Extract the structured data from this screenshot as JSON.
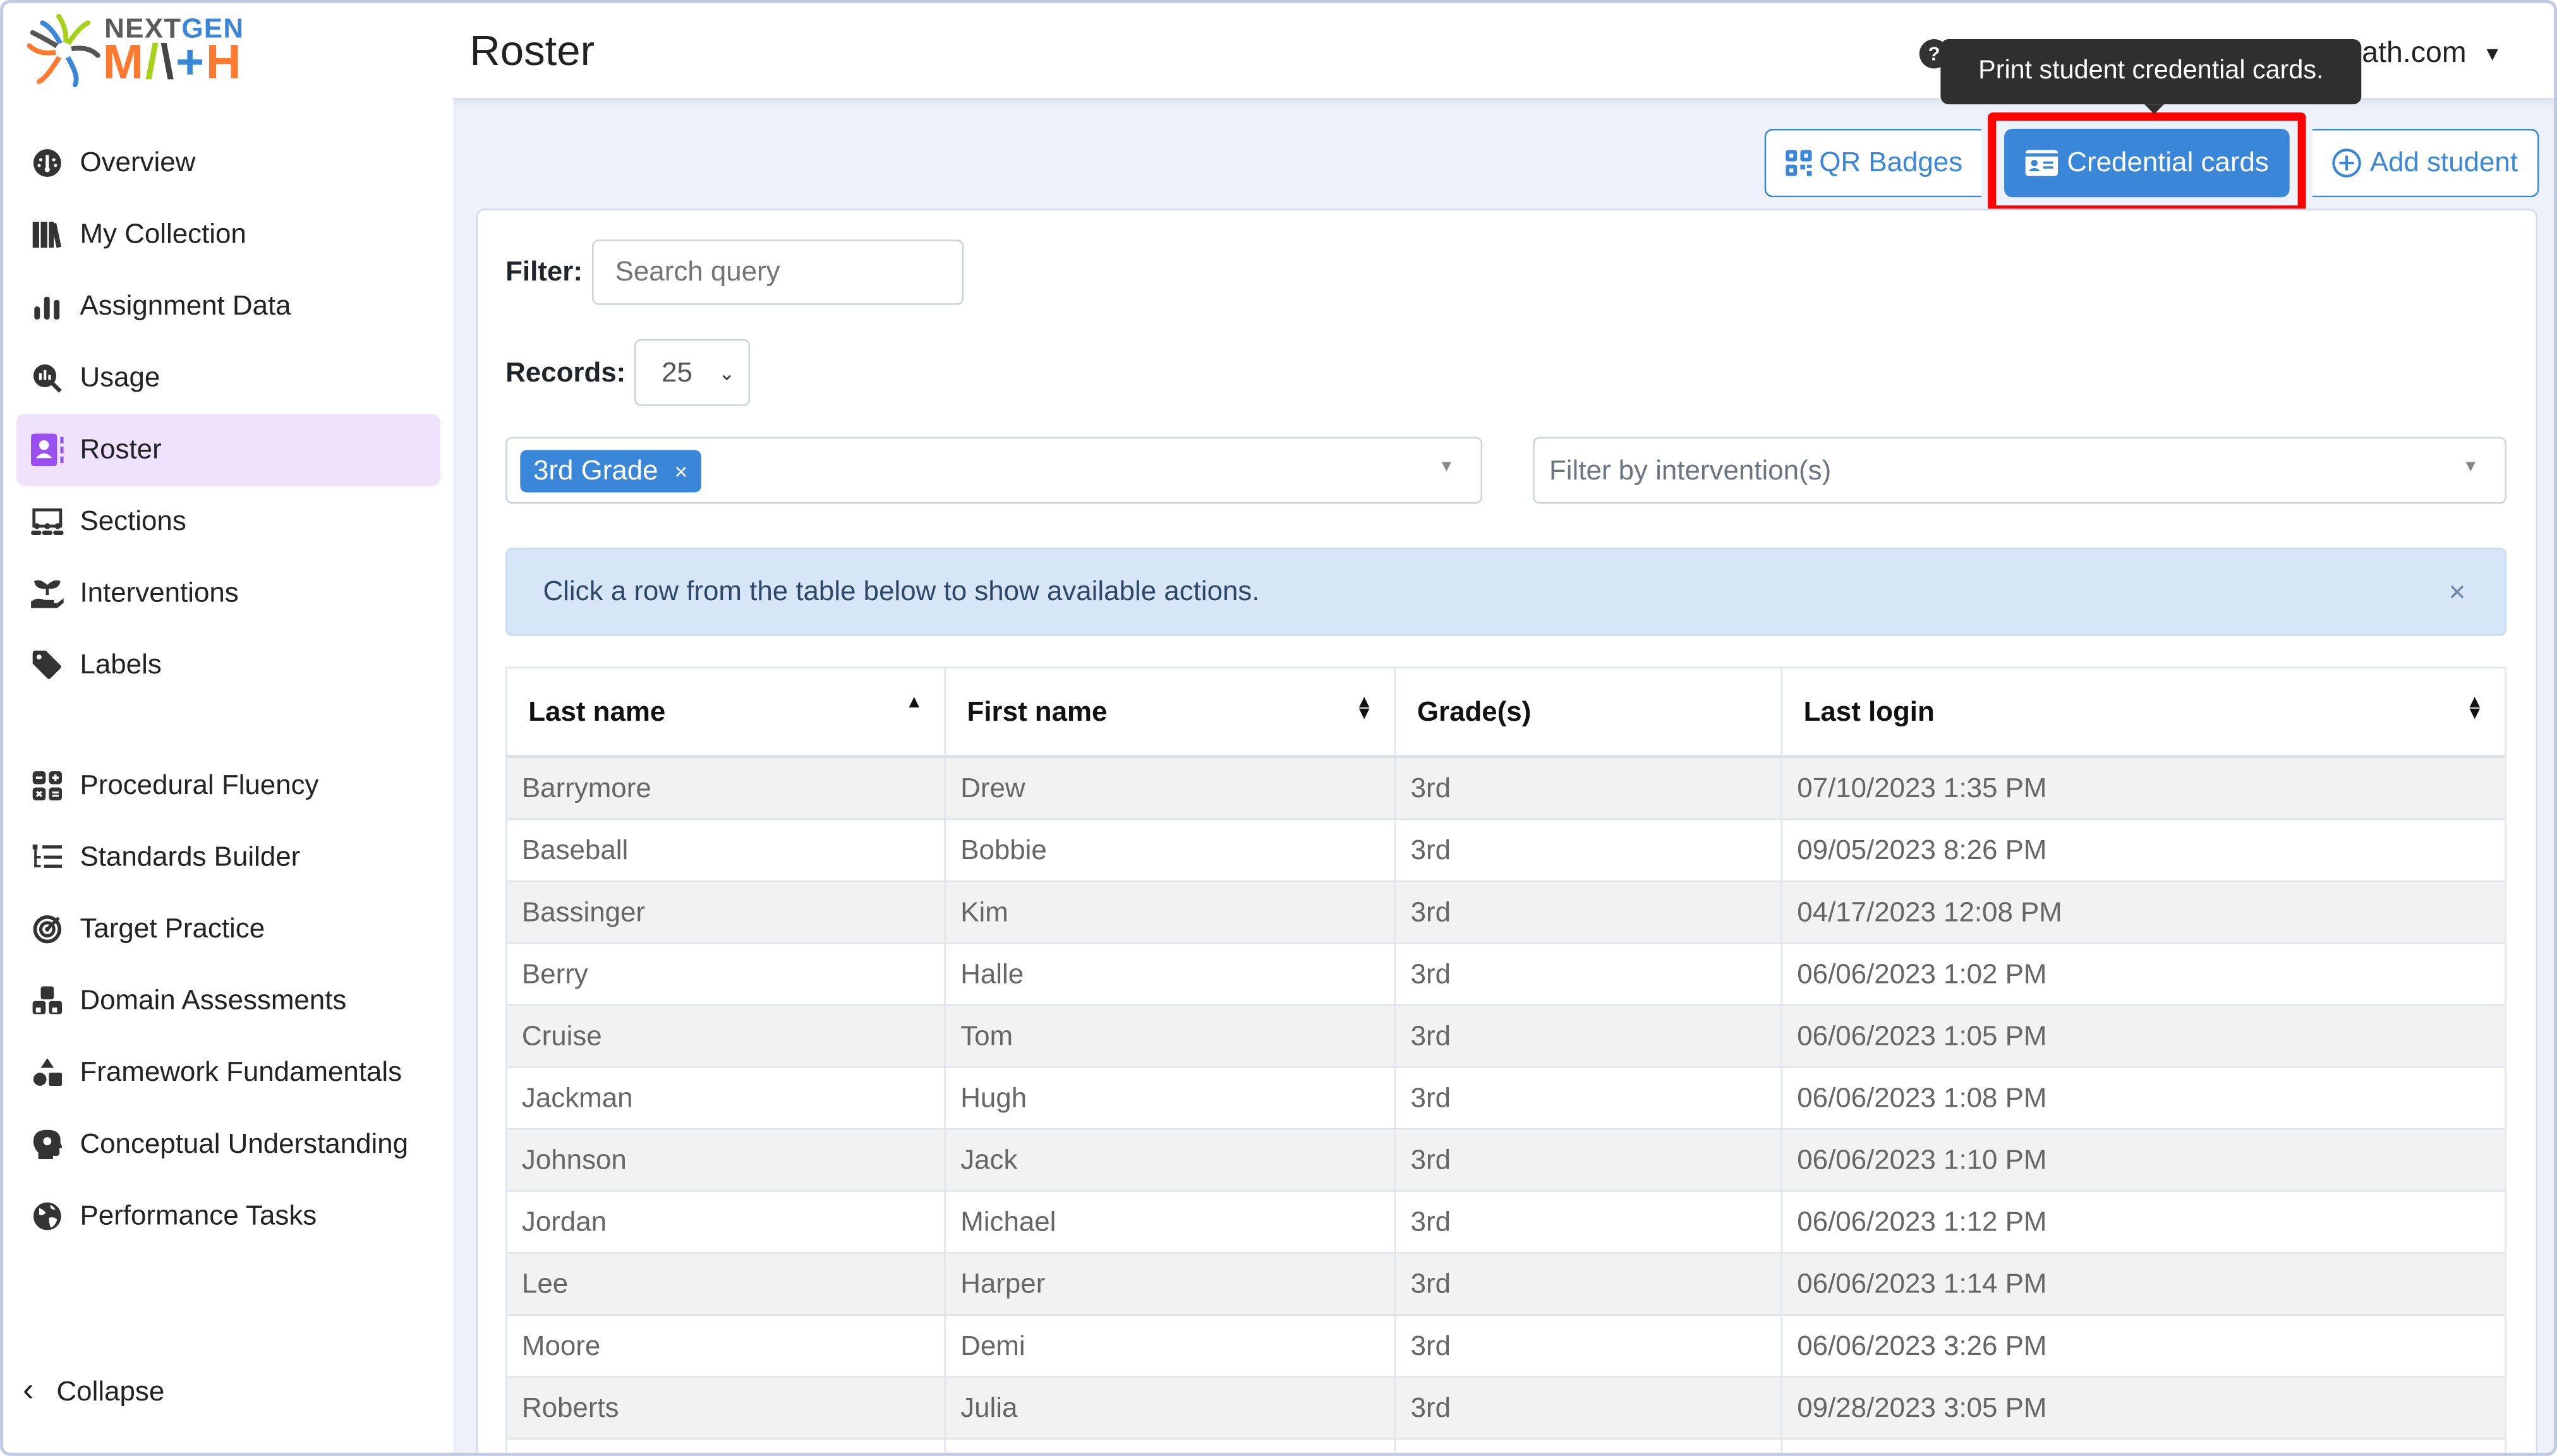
{
  "brand": {
    "name_part1": "NEXT",
    "name_part2": "GEN",
    "name_line2": "MATH"
  },
  "sidebar": {
    "items": [
      {
        "label": "Overview",
        "icon": "dashboard-gauge-icon",
        "active": false
      },
      {
        "label": "My Collection",
        "icon": "book-collection-icon",
        "active": false
      },
      {
        "label": "Assignment Data",
        "icon": "bar-chart-icon",
        "active": false
      },
      {
        "label": "Usage",
        "icon": "magnifier-chart-icon",
        "active": false
      },
      {
        "label": "Roster",
        "icon": "address-book-icon",
        "active": true
      },
      {
        "label": "Sections",
        "icon": "chalkboard-users-icon",
        "active": false
      },
      {
        "label": "Interventions",
        "icon": "hand-seedling-icon",
        "active": false
      },
      {
        "label": "Labels",
        "icon": "tag-icon",
        "active": false
      },
      {
        "label": "Procedural Fluency",
        "icon": "calculator-ops-icon",
        "active": false
      },
      {
        "label": "Standards Builder",
        "icon": "list-tree-icon",
        "active": false
      },
      {
        "label": "Target Practice",
        "icon": "bullseye-arrow-icon",
        "active": false
      },
      {
        "label": "Domain Assessments",
        "icon": "cubes-icon",
        "active": false
      },
      {
        "label": "Framework Fundamentals",
        "icon": "shapes-icon",
        "active": false
      },
      {
        "label": "Conceptual Understanding",
        "icon": "head-brain-icon",
        "active": false
      },
      {
        "label": "Performance Tasks",
        "icon": "globe-icon",
        "active": false
      }
    ],
    "collapse_label": "Collapse"
  },
  "header": {
    "title": "Roster",
    "help": "?",
    "user_email": "kevin-the-dog@nextgenmath.com"
  },
  "tooltip": "Print student credential cards.",
  "toolbar": {
    "qr_badges": "QR Badges",
    "credential_cards": "Credential cards",
    "add_student": "Add student"
  },
  "filters": {
    "filter_label": "Filter:",
    "search_placeholder": "Search query",
    "search_value": "",
    "records_label": "Records:",
    "records_value": "25",
    "grade_chip": "3rd Grade",
    "intervention_placeholder": "Filter by intervention(s)"
  },
  "alert": {
    "message": "Click a row from the table below to show available actions.",
    "close": "×"
  },
  "table": {
    "columns": [
      "Last name",
      "First name",
      "Grade(s)",
      "Last login"
    ],
    "rows": [
      [
        "Barrymore",
        "Drew",
        "3rd",
        "07/10/2023 1:35 PM"
      ],
      [
        "Baseball",
        "Bobbie",
        "3rd",
        "09/05/2023 8:26 PM"
      ],
      [
        "Bassinger",
        "Kim",
        "3rd",
        "04/17/2023 12:08 PM"
      ],
      [
        "Berry",
        "Halle",
        "3rd",
        "06/06/2023 1:02 PM"
      ],
      [
        "Cruise",
        "Tom",
        "3rd",
        "06/06/2023 1:05 PM"
      ],
      [
        "Jackman",
        "Hugh",
        "3rd",
        "06/06/2023 1:08 PM"
      ],
      [
        "Johnson",
        "Jack",
        "3rd",
        "06/06/2023 1:10 PM"
      ],
      [
        "Jordan",
        "Michael",
        "3rd",
        "06/06/2023 1:12 PM"
      ],
      [
        "Lee",
        "Harper",
        "3rd",
        "06/06/2023 1:14 PM"
      ],
      [
        "Moore",
        "Demi",
        "3rd",
        "06/06/2023 3:26 PM"
      ],
      [
        "Roberts",
        "Julia",
        "3rd",
        "09/28/2023 3:05 PM"
      ]
    ]
  },
  "colors": {
    "accent": "#3a86d8",
    "active_nav_bg": "#efe2fd",
    "active_icon": "#9a4ff0",
    "highlight": "#ff0000"
  }
}
